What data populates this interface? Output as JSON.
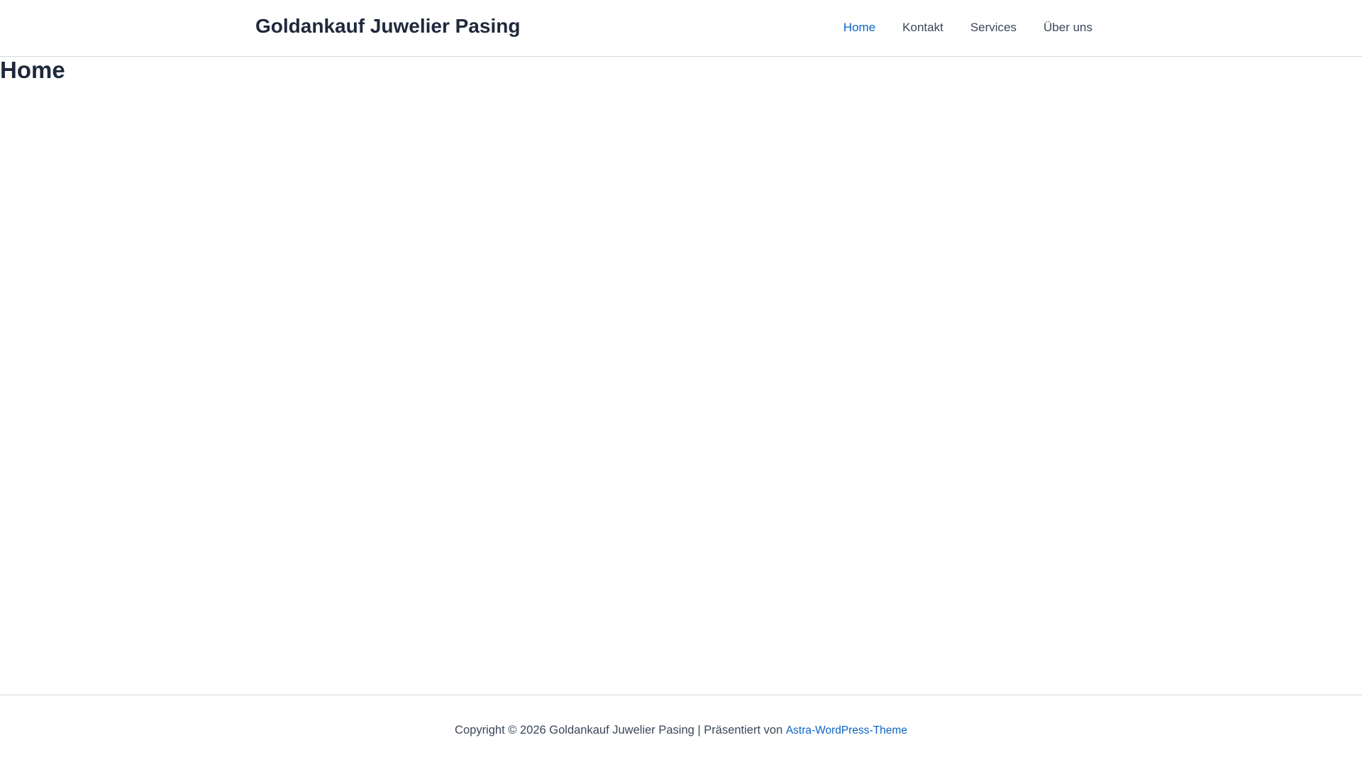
{
  "header": {
    "site_title": "Goldankauf Juwelier Pasing",
    "nav": [
      {
        "label": "Home",
        "active": true
      },
      {
        "label": "Kontakt"
      },
      {
        "label": "Services"
      },
      {
        "label": "Über uns"
      }
    ]
  },
  "main": {
    "title": "Home"
  },
  "footer": {
    "copyright": "Copyright © 2026 Goldankauf Juwelier Pasing | Präsentiert von ",
    "theme_link": "Astra-WordPress-Theme"
  },
  "colors": {
    "accent": "#0b64c5",
    "text": "#3a4759",
    "heading": "#1e293b"
  }
}
